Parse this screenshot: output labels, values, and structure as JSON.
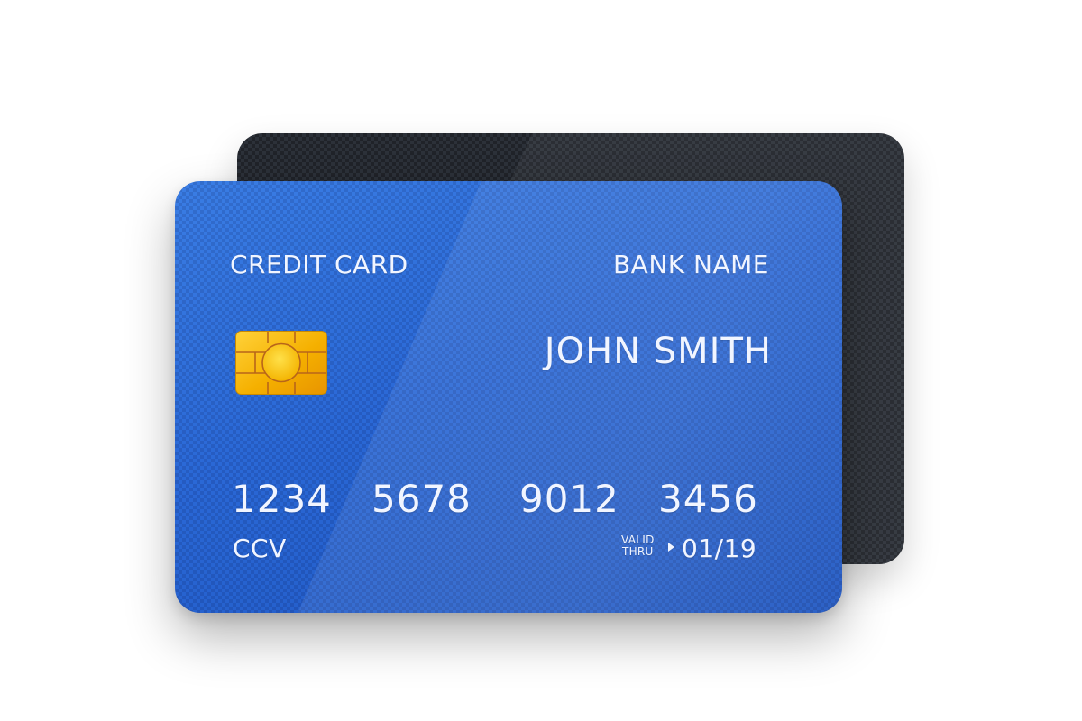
{
  "card": {
    "type_label": "CREDIT CARD",
    "bank_name": "BANK NAME",
    "cardholder": "JOHN SMITH",
    "number_groups": [
      "1234",
      "5678",
      "9012",
      "3456"
    ],
    "ccv_label": "CCV",
    "valid_thru_line1": "VALID",
    "valid_thru_line2": "THRU",
    "expiry": "01/19"
  },
  "icons": {
    "chip": "emv-chip-icon",
    "arrow": "triangle-right-icon"
  },
  "colors": {
    "front_card": "#2966d3",
    "back_card": "#2c3139",
    "chip": "#f5b800",
    "text": "#f1f5ff"
  }
}
